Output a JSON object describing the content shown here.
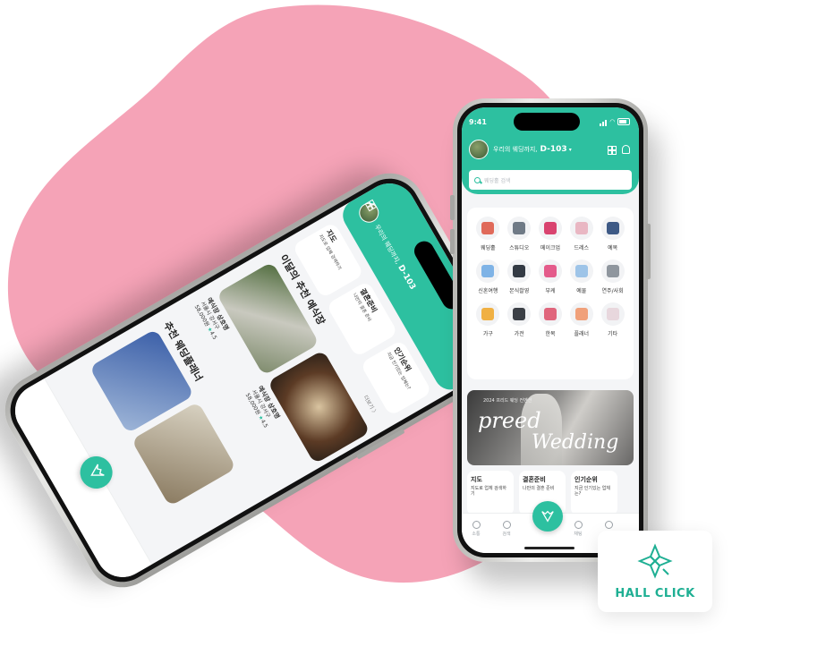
{
  "colors": {
    "accent": "#2dc0a0",
    "blob": "#f5a3b7",
    "logo": "#1eaf93"
  },
  "status": {
    "time": "9:41"
  },
  "header": {
    "greeting": "우리의 웨딩까지,",
    "dday": "D-103",
    "caret": "▾",
    "search_placeholder": "웨딩홀 검색"
  },
  "categories": [
    {
      "label": "웨딩홀",
      "color": "#e06a5a"
    },
    {
      "label": "스튜디오",
      "color": "#6f7a86"
    },
    {
      "label": "메이크업",
      "color": "#d9436f"
    },
    {
      "label": "드레스",
      "color": "#e9b7c3"
    },
    {
      "label": "예복",
      "color": "#3e5a86"
    },
    {
      "label": "신혼여행",
      "color": "#7fb3e6"
    },
    {
      "label": "본식촬영",
      "color": "#333a44"
    },
    {
      "label": "부케",
      "color": "#e45b8b"
    },
    {
      "label": "예물",
      "color": "#9ec4e8"
    },
    {
      "label": "연주/사회",
      "color": "#8f969e"
    },
    {
      "label": "가구",
      "color": "#f0b043"
    },
    {
      "label": "가전",
      "color": "#3b3f46"
    },
    {
      "label": "한복",
      "color": "#e0657c"
    },
    {
      "label": "플래너",
      "color": "#f0a07a"
    },
    {
      "label": "기타",
      "color": "#e8d7dd"
    }
  ],
  "banner": {
    "small": "2024 프리드 웨딩 컨벤션",
    "word1": "preed",
    "word2": "Wedding"
  },
  "info_cards": [
    {
      "title": "지도",
      "sub": "지도로 업체 검색하기"
    },
    {
      "title": "결혼준비",
      "sub": "나만의 결혼 준비"
    },
    {
      "title": "인기순위",
      "sub": "지금 인기있는 업체는?"
    }
  ],
  "nav": [
    {
      "label": "소통"
    },
    {
      "label": "검색"
    },
    {
      "label": "웨딩"
    },
    {
      "label": "채팅"
    },
    {
      "label": "마이"
    }
  ],
  "left": {
    "section_title": "이달의 추천 예식장",
    "more": "더보기 〉",
    "venues": [
      {
        "name": "예식장 상호명",
        "addr": "서울시 강서구",
        "price": "58,000원",
        "rating": "4.5"
      },
      {
        "name": "예식장 상호명",
        "addr": "서울시 강서구",
        "price": "58,000원",
        "rating": "4.5"
      },
      {
        "name": "예식장 상호명",
        "addr": "서울시 강서구",
        "price": "58,000원",
        "rating": "4.5"
      }
    ],
    "planner_title": "추천 웨딩플래너"
  },
  "logo": {
    "text": "HALL CLICK"
  }
}
